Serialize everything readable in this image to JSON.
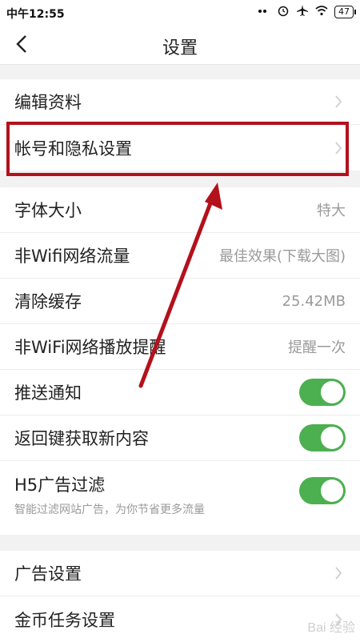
{
  "status_bar": {
    "time": "中午12:55",
    "battery": "47"
  },
  "header": {
    "title": "设置"
  },
  "section1": {
    "items": [
      {
        "label": "编辑资料"
      },
      {
        "label": "帐号和隐私设置"
      }
    ]
  },
  "section2": {
    "items": [
      {
        "label": "字体大小",
        "value": "特大"
      },
      {
        "label": "非Wifi网络流量",
        "value": "最佳效果(下载大图)"
      },
      {
        "label": "清除缓存",
        "value": "25.42MB"
      },
      {
        "label": "非WiFi网络播放提醒",
        "value": "提醒一次"
      },
      {
        "label": "推送通知",
        "toggle_on": true
      },
      {
        "label": "返回键获取新内容",
        "toggle_on": true
      },
      {
        "label": "H5广告过滤",
        "sublabel": "智能过滤网站广告，为你节省更多流量",
        "toggle_on": true
      }
    ]
  },
  "section3": {
    "items": [
      {
        "label": "广告设置"
      },
      {
        "label": "金币任务设置"
      }
    ]
  },
  "watermark": "Bai 经验",
  "colors": {
    "toggle_on": "#4caf50",
    "highlight": "#b3111c"
  }
}
